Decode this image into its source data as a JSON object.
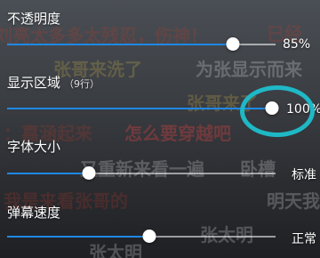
{
  "background_danmaku": [
    {
      "text": "刘亮太多多太残忍，伤神！",
      "color": "red"
    },
    {
      "text": "已经",
      "color": "red"
    },
    {
      "text": "张哥来洗了",
      "color": "yellow"
    },
    {
      "text": "为张显示而来",
      "color": "white"
    },
    {
      "text": "张哥来了",
      "color": "yellow"
    },
    {
      "text": "：嘉涵起来",
      "color": "red"
    },
    {
      "text": "怎么要穿越吧",
      "color": "bold-red"
    },
    {
      "text": "又重新来看一遍",
      "color": "white"
    },
    {
      "text": "卧槽",
      "color": "white"
    },
    {
      "text": "我是来看张哥的",
      "color": "red"
    },
    {
      "text": "明天我",
      "color": "white"
    },
    {
      "text": "张太明",
      "color": "white"
    },
    {
      "text": "张太明",
      "color": "white"
    }
  ],
  "settings": [
    {
      "id": "opacity",
      "label": "不透明度",
      "sublabel": "",
      "value": "85%",
      "level": 0.85
    },
    {
      "id": "display_area",
      "label": "显示区域",
      "sublabel": "（9行）",
      "value": "100%",
      "level": 1.0
    },
    {
      "id": "font_size",
      "label": "字体大小",
      "sublabel": "",
      "value": "标准",
      "level": 0.3
    },
    {
      "id": "speed",
      "label": "弹幕速度",
      "sublabel": "",
      "value": "正常",
      "level": 0.53
    }
  ],
  "colors": {
    "accent": "#1e88e5",
    "highlight_ring": "#1fb8c6"
  }
}
